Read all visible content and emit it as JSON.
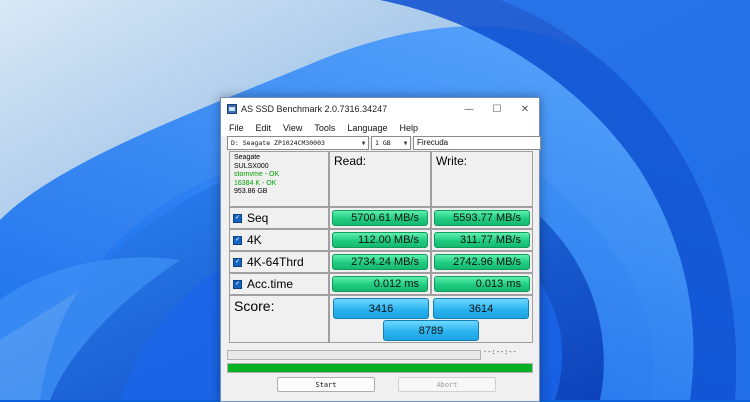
{
  "window": {
    "title": "AS SSD Benchmark 2.0.7316.34247",
    "controls": {
      "minimize": "—",
      "maximize": "☐",
      "close": "✕"
    }
  },
  "menu": [
    "File",
    "Edit",
    "View",
    "Tools",
    "Language",
    "Help"
  ],
  "toolbar": {
    "drive": "D: Seagate ZP1024CM30003",
    "size": "1 GB",
    "name": "Firecuda"
  },
  "info": {
    "lines": [
      "Seagate",
      "SULSX000"
    ],
    "ok_lines": [
      "stornvme - OK",
      "16384 K - OK"
    ],
    "capacity": "953.86 GB"
  },
  "columns": {
    "read": "Read:",
    "write": "Write:"
  },
  "rows": [
    {
      "label": "Seq",
      "read": "5700.61 MB/s",
      "write": "5593.77 MB/s"
    },
    {
      "label": "4K",
      "read": "112.00 MB/s",
      "write": "311.77 MB/s"
    },
    {
      "label": "4K-64Thrd",
      "read": "2734.24 MB/s",
      "write": "2742.96 MB/s"
    },
    {
      "label": "Acc.time",
      "read": "0.012 ms",
      "write": "0.013 ms"
    }
  ],
  "score": {
    "label": "Score:",
    "read": "3416",
    "write": "3614",
    "total": "8789"
  },
  "status": {
    "elapsed": "--:--:--",
    "progress": 1.0,
    "progress_color": "#06b025"
  },
  "buttons": {
    "start": "Start",
    "abort": "Abort"
  }
}
